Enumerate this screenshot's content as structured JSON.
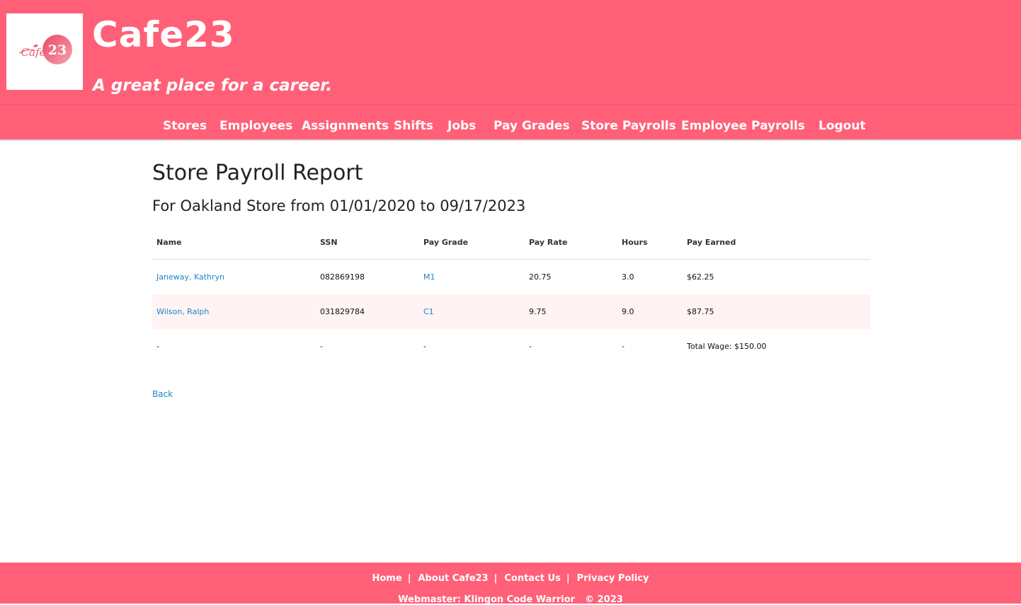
{
  "header": {
    "logo_text": "Cafe23",
    "title": "Cafe23",
    "tagline": "A great place for a career."
  },
  "nav": {
    "items": [
      {
        "label": "Stores"
      },
      {
        "label": "Employees"
      },
      {
        "label": "Assignments"
      },
      {
        "label": "Shifts"
      },
      {
        "label": "Jobs"
      },
      {
        "label": "Pay Grades"
      },
      {
        "label": "Store Payrolls"
      },
      {
        "label": "Employee Payrolls"
      }
    ],
    "logout_label": "Logout"
  },
  "main": {
    "title": "Store Payroll Report",
    "subtitle": "For Oakland Store from 01/01/2020 to 09/17/2023",
    "table": {
      "headers": [
        "Name",
        "SSN",
        "Pay Grade",
        "Pay Rate",
        "Hours",
        "Pay Earned"
      ],
      "rows": [
        {
          "name": "Janeway, Kathryn",
          "ssn": "082869198",
          "pay_grade": "M1",
          "pay_rate": "20.75",
          "hours": "3.0",
          "pay_earned": "$62.25"
        },
        {
          "name": "Wilson, Ralph",
          "ssn": "031829784",
          "pay_grade": "C1",
          "pay_rate": "9.75",
          "hours": "9.0",
          "pay_earned": "$87.75"
        }
      ],
      "total_row": {
        "name": "-",
        "ssn": "-",
        "pay_grade": "-",
        "pay_rate": "-",
        "hours": "-",
        "pay_earned": "Total Wage: $150.00"
      }
    },
    "back_label": "Back"
  },
  "footer": {
    "links": [
      {
        "label": "Home"
      },
      {
        "label": "About Cafe23"
      },
      {
        "label": "Contact Us"
      },
      {
        "label": "Privacy Policy"
      }
    ],
    "separator": "|",
    "credit": "Webmaster: Klingon Code Warrior",
    "copyright": "© 2023"
  },
  "colors": {
    "brand": "#ff6078",
    "link": "#1a86c6",
    "row_stripe": "#fff3f3"
  }
}
